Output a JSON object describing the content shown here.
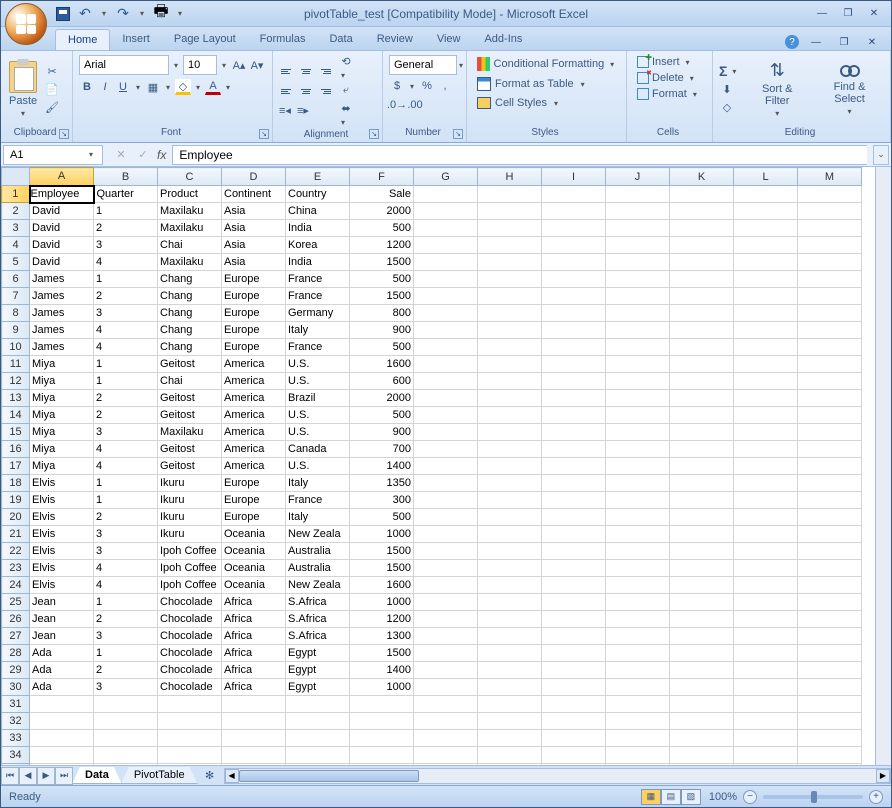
{
  "title": "pivotTable_test  [Compatibility Mode] - Microsoft Excel",
  "tabs": [
    "Home",
    "Insert",
    "Page Layout",
    "Formulas",
    "Data",
    "Review",
    "View",
    "Add-Ins"
  ],
  "activeTab": 0,
  "ribbon": {
    "clipboard": {
      "label": "Clipboard",
      "paste": "Paste"
    },
    "font": {
      "label": "Font",
      "name": "Arial",
      "size": "10"
    },
    "alignment": {
      "label": "Alignment"
    },
    "number": {
      "label": "Number",
      "format": "General"
    },
    "styles": {
      "label": "Styles",
      "cond": "Conditional Formatting",
      "table": "Format as Table",
      "cell": "Cell Styles"
    },
    "cells": {
      "label": "Cells",
      "insert": "Insert",
      "delete": "Delete",
      "format": "Format"
    },
    "editing": {
      "label": "Editing",
      "sort": "Sort & Filter",
      "find": "Find & Select"
    }
  },
  "namebox": "A1",
  "formula": "Employee",
  "columns": [
    "A",
    "B",
    "C",
    "D",
    "E",
    "F",
    "G",
    "H",
    "I",
    "J",
    "K",
    "L",
    "M"
  ],
  "selectedCell": {
    "row": 0,
    "col": 0
  },
  "headers": [
    "Employee",
    "Quarter",
    "Product",
    "Continent",
    "Country",
    "Sale"
  ],
  "rows": [
    [
      "David",
      "1",
      "Maxilaku",
      "Asia",
      "China",
      "2000"
    ],
    [
      "David",
      "2",
      "Maxilaku",
      "Asia",
      "India",
      "500"
    ],
    [
      "David",
      "3",
      "Chai",
      "Asia",
      "Korea",
      "1200"
    ],
    [
      "David",
      "4",
      "Maxilaku",
      "Asia",
      "India",
      "1500"
    ],
    [
      "James",
      "1",
      "Chang",
      "Europe",
      "France",
      "500"
    ],
    [
      "James",
      "2",
      "Chang",
      "Europe",
      "France",
      "1500"
    ],
    [
      "James",
      "3",
      "Chang",
      "Europe",
      "Germany",
      "800"
    ],
    [
      "James",
      "4",
      "Chang",
      "Europe",
      "Italy",
      "900"
    ],
    [
      "James",
      "4",
      "Chang",
      "Europe",
      "France",
      "500"
    ],
    [
      "Miya",
      "1",
      "Geitost",
      "America",
      "U.S.",
      "1600"
    ],
    [
      "Miya",
      "1",
      "Chai",
      "America",
      "U.S.",
      "600"
    ],
    [
      "Miya",
      "2",
      "Geitost",
      "America",
      "Brazil",
      "2000"
    ],
    [
      "Miya",
      "2",
      "Geitost",
      "America",
      "U.S.",
      "500"
    ],
    [
      "Miya",
      "3",
      "Maxilaku",
      "America",
      "U.S.",
      "900"
    ],
    [
      "Miya",
      "4",
      "Geitost",
      "America",
      "Canada",
      "700"
    ],
    [
      "Miya",
      "4",
      "Geitost",
      "America",
      "U.S.",
      "1400"
    ],
    [
      "Elvis",
      "1",
      "Ikuru",
      "Europe",
      "Italy",
      "1350"
    ],
    [
      "Elvis",
      "1",
      "Ikuru",
      "Europe",
      "France",
      "300"
    ],
    [
      "Elvis",
      "2",
      "Ikuru",
      "Europe",
      "Italy",
      "500"
    ],
    [
      "Elvis",
      "3",
      "Ikuru",
      "Oceania",
      "New Zeala",
      "1000"
    ],
    [
      "Elvis",
      "3",
      "Ipoh Coffee",
      "Oceania",
      "Australia",
      "1500"
    ],
    [
      "Elvis",
      "4",
      "Ipoh Coffee",
      "Oceania",
      "Australia",
      "1500"
    ],
    [
      "Elvis",
      "4",
      "Ipoh Coffee",
      "Oceania",
      "New Zeala",
      "1600"
    ],
    [
      "Jean",
      "1",
      "Chocolade",
      "Africa",
      "S.Africa",
      "1000"
    ],
    [
      "Jean",
      "2",
      "Chocolade",
      "Africa",
      "S.Africa",
      "1200"
    ],
    [
      "Jean",
      "3",
      "Chocolade",
      "Africa",
      "S.Africa",
      "1300"
    ],
    [
      "Ada",
      "1",
      "Chocolade",
      "Africa",
      "Egypt",
      "1500"
    ],
    [
      "Ada",
      "2",
      "Chocolade",
      "Africa",
      "Egypt",
      "1400"
    ],
    [
      "Ada",
      "3",
      "Chocolade",
      "Africa",
      "Egypt",
      "1000"
    ]
  ],
  "emptyRows": 5,
  "sheets": [
    "Data",
    "PivotTable"
  ],
  "activeSheet": 0,
  "status": "Ready",
  "zoom": "100%"
}
